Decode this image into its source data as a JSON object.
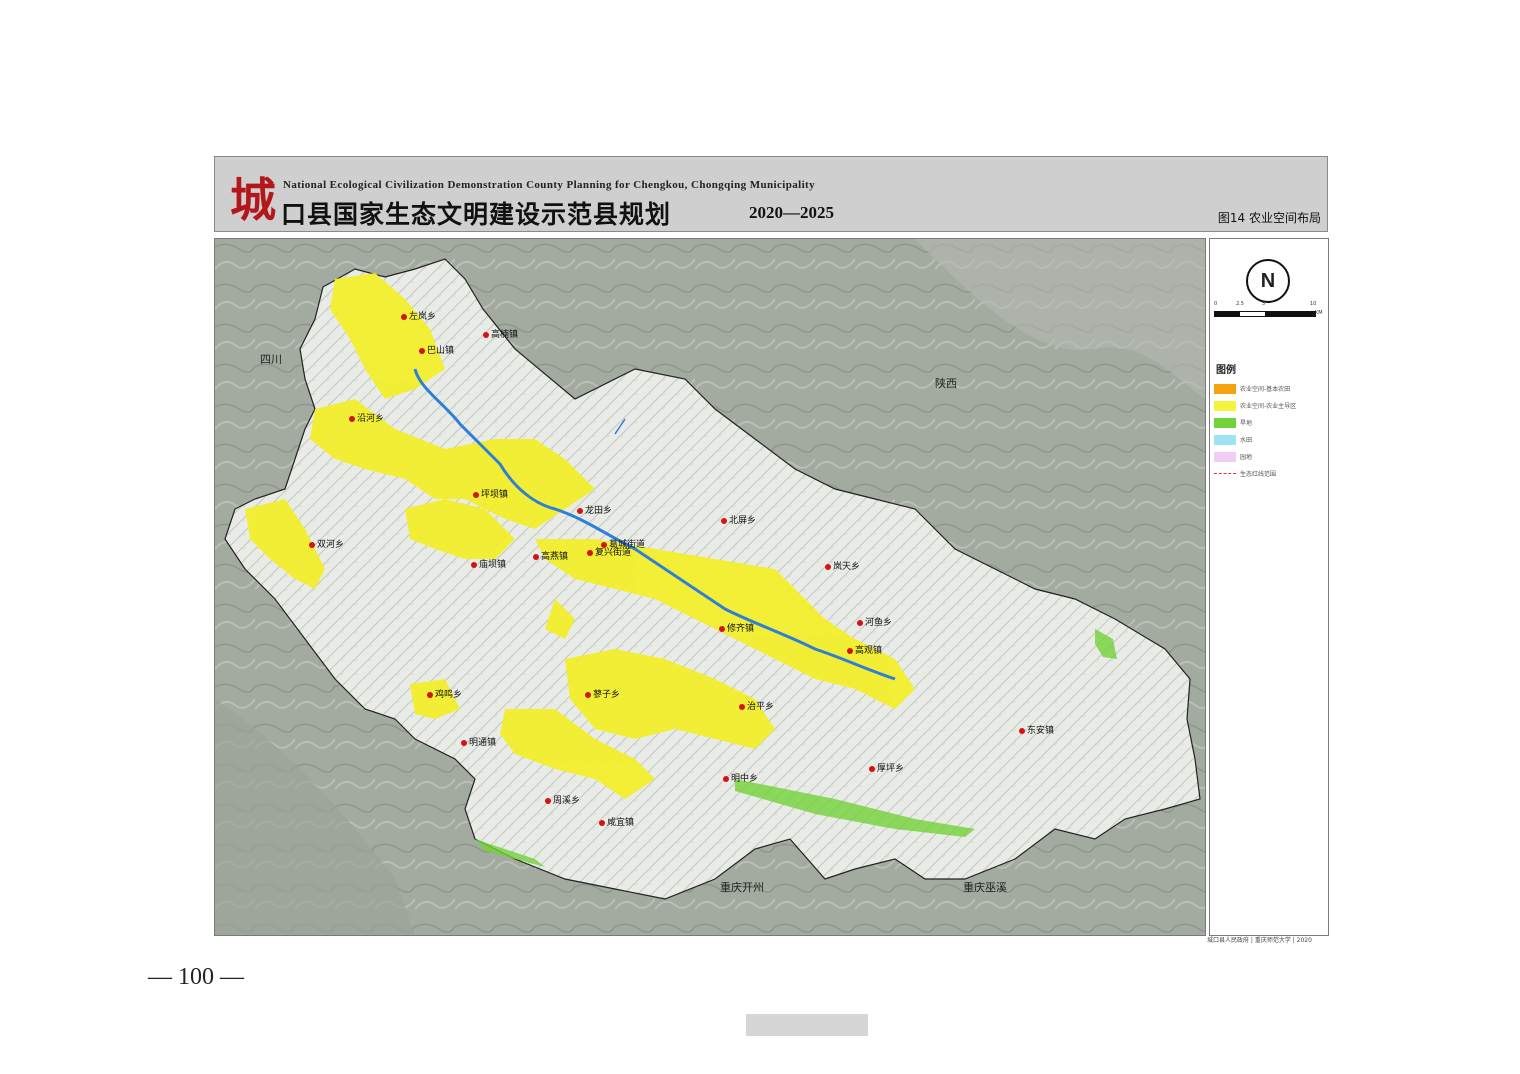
{
  "header": {
    "seal_char": "城",
    "subtitle": "National Ecological Civilization Demonstration County Planning for Chengkou, Chongqing Municipality",
    "title": "口县国家生态文明建设示范县规划",
    "years": "2020—2025",
    "figure_label": "图14  农业空间布局"
  },
  "map": {
    "regions": {
      "sichuan": "四川",
      "shaanxi": "陕西",
      "kaizhou": "重庆开州",
      "wuxi": "重庆巫溪"
    },
    "places": [
      {
        "label": "左岚乡"
      },
      {
        "label": "高楠镇"
      },
      {
        "label": "巴山镇"
      },
      {
        "label": "沿河乡"
      },
      {
        "label": "坪坝镇"
      },
      {
        "label": "龙田乡"
      },
      {
        "label": "北屏乡"
      },
      {
        "label": "双河乡"
      },
      {
        "label": "高燕镇"
      },
      {
        "label": "复兴街道"
      },
      {
        "label": "葛城街道"
      },
      {
        "label": "庙坝镇"
      },
      {
        "label": "岚天乡"
      },
      {
        "label": "修齐镇"
      },
      {
        "label": "河鱼乡"
      },
      {
        "label": "高观镇"
      },
      {
        "label": "蓼子乡"
      },
      {
        "label": "鸡鸣乡"
      },
      {
        "label": "治平乡"
      },
      {
        "label": "明通镇"
      },
      {
        "label": "东安镇"
      },
      {
        "label": "明中乡"
      },
      {
        "label": "厚坪乡"
      },
      {
        "label": "周溪乡"
      },
      {
        "label": "咸宜镇"
      }
    ]
  },
  "legend": {
    "compass_letter": "N",
    "scale_ticks": [
      "0",
      "2.5",
      "5",
      "10"
    ],
    "scale_unit": "KM",
    "title": "图例",
    "items": [
      {
        "label": "农业空间-基本农田",
        "color": "#f2a30f"
      },
      {
        "label": "农业空间-农业主导区",
        "color": "#f4f43a"
      },
      {
        "label": "旱地",
        "color": "#72d23a"
      },
      {
        "label": "水田",
        "color": "#9fe3f2"
      },
      {
        "label": "园地",
        "color": "#f1cdf3"
      },
      {
        "label": "生态红线范围",
        "color": "#d23a3a"
      }
    ]
  },
  "footer": {
    "credit": "城口县人民政府 | 重庆师范大学 | 2020",
    "page_number": "— 100 —"
  }
}
